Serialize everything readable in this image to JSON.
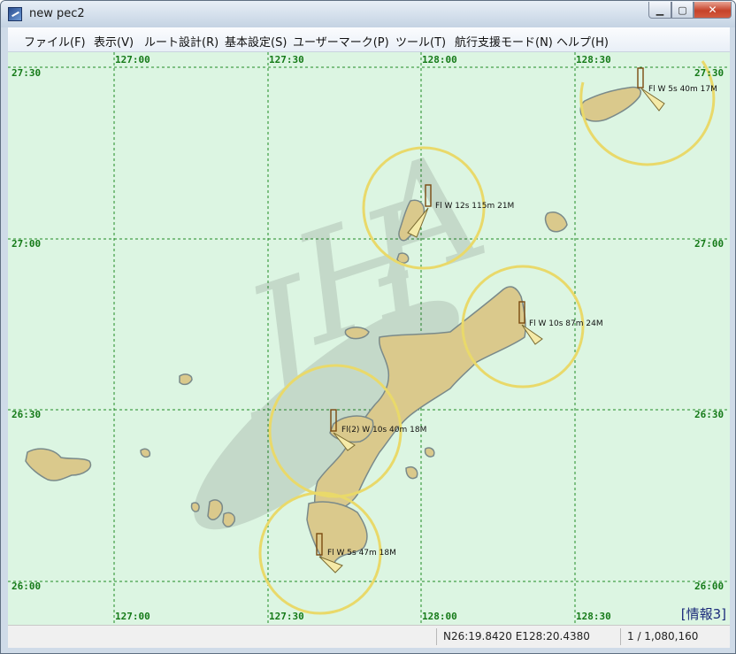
{
  "window": {
    "title": "new pec2"
  },
  "menu": [
    "ファイル(F)",
    "表示(V)",
    "ルート設計(R)",
    "基本設定(S)",
    "ユーザーマーク(P)",
    "ツール(T)",
    "航行支援モード(N)",
    "ヘルプ(H)"
  ],
  "chart": {
    "latitude_labels": [
      "27:30",
      "27:00",
      "26:30",
      "26:00"
    ],
    "longitude_labels": [
      "127:00",
      "127:30",
      "128:00",
      "128:30"
    ],
    "watermark": "JHA",
    "lights": [
      "Fl W 5s 40m 17M",
      "Fl W 12s 115m 21M",
      "Fl W 10s 87m 24M",
      "Fl(2) W 10s 40m 18M",
      "Fl W 5s 47m 18M"
    ],
    "info_label": "[情報3]",
    "colors": {
      "sea": "#dcf5e2",
      "land": "#dac98c",
      "grid": "#1f8a24",
      "sector": "#e9d96a"
    }
  },
  "status": {
    "blank": "",
    "position": "N26:19.8420 E128:20.4380",
    "scale": "1 / 1,080,160"
  }
}
